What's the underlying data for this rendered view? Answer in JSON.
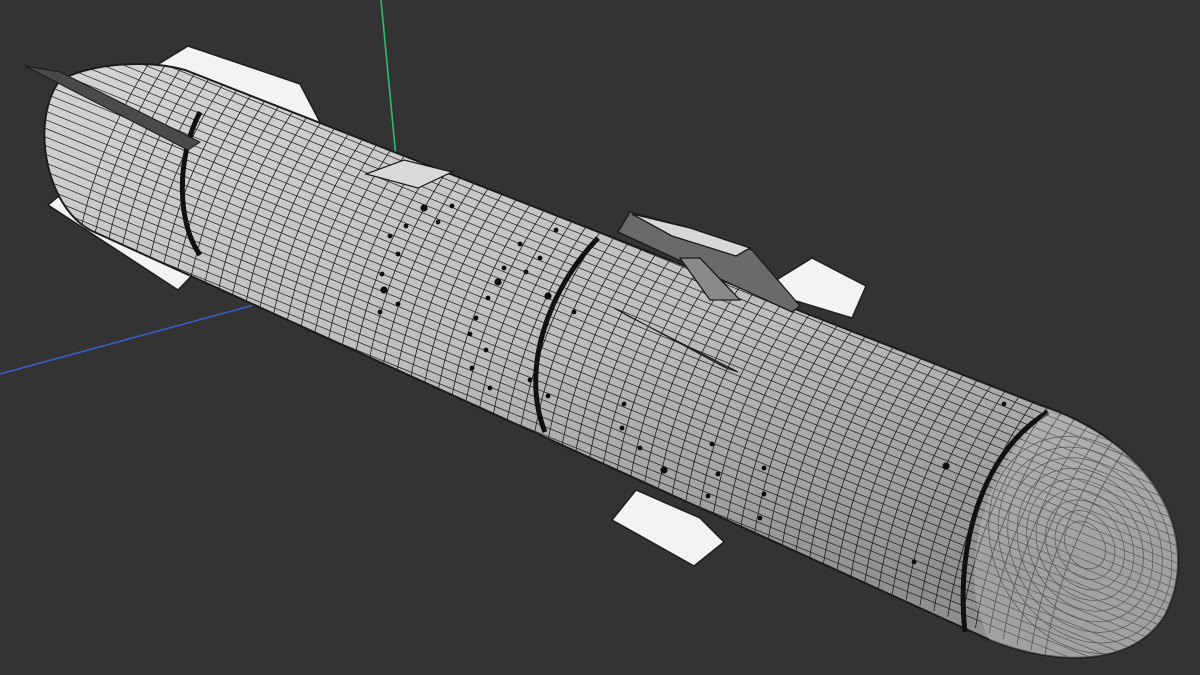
{
  "viewport": {
    "background": "#333333",
    "axis_colors": {
      "y_axis": "#2ebd6b",
      "x_axis": "#3a5fc8"
    }
  },
  "model": {
    "body_fill": "#b9b9b9",
    "body_fill_light": "#d2d2d2",
    "body_fill_dark": "#8e8e8e",
    "wire_color": "#1c1c1c",
    "fin_fill": "#f3f3f3",
    "fin_edge": "#1e1e1e",
    "detail_fill": "#6e6e6e"
  }
}
